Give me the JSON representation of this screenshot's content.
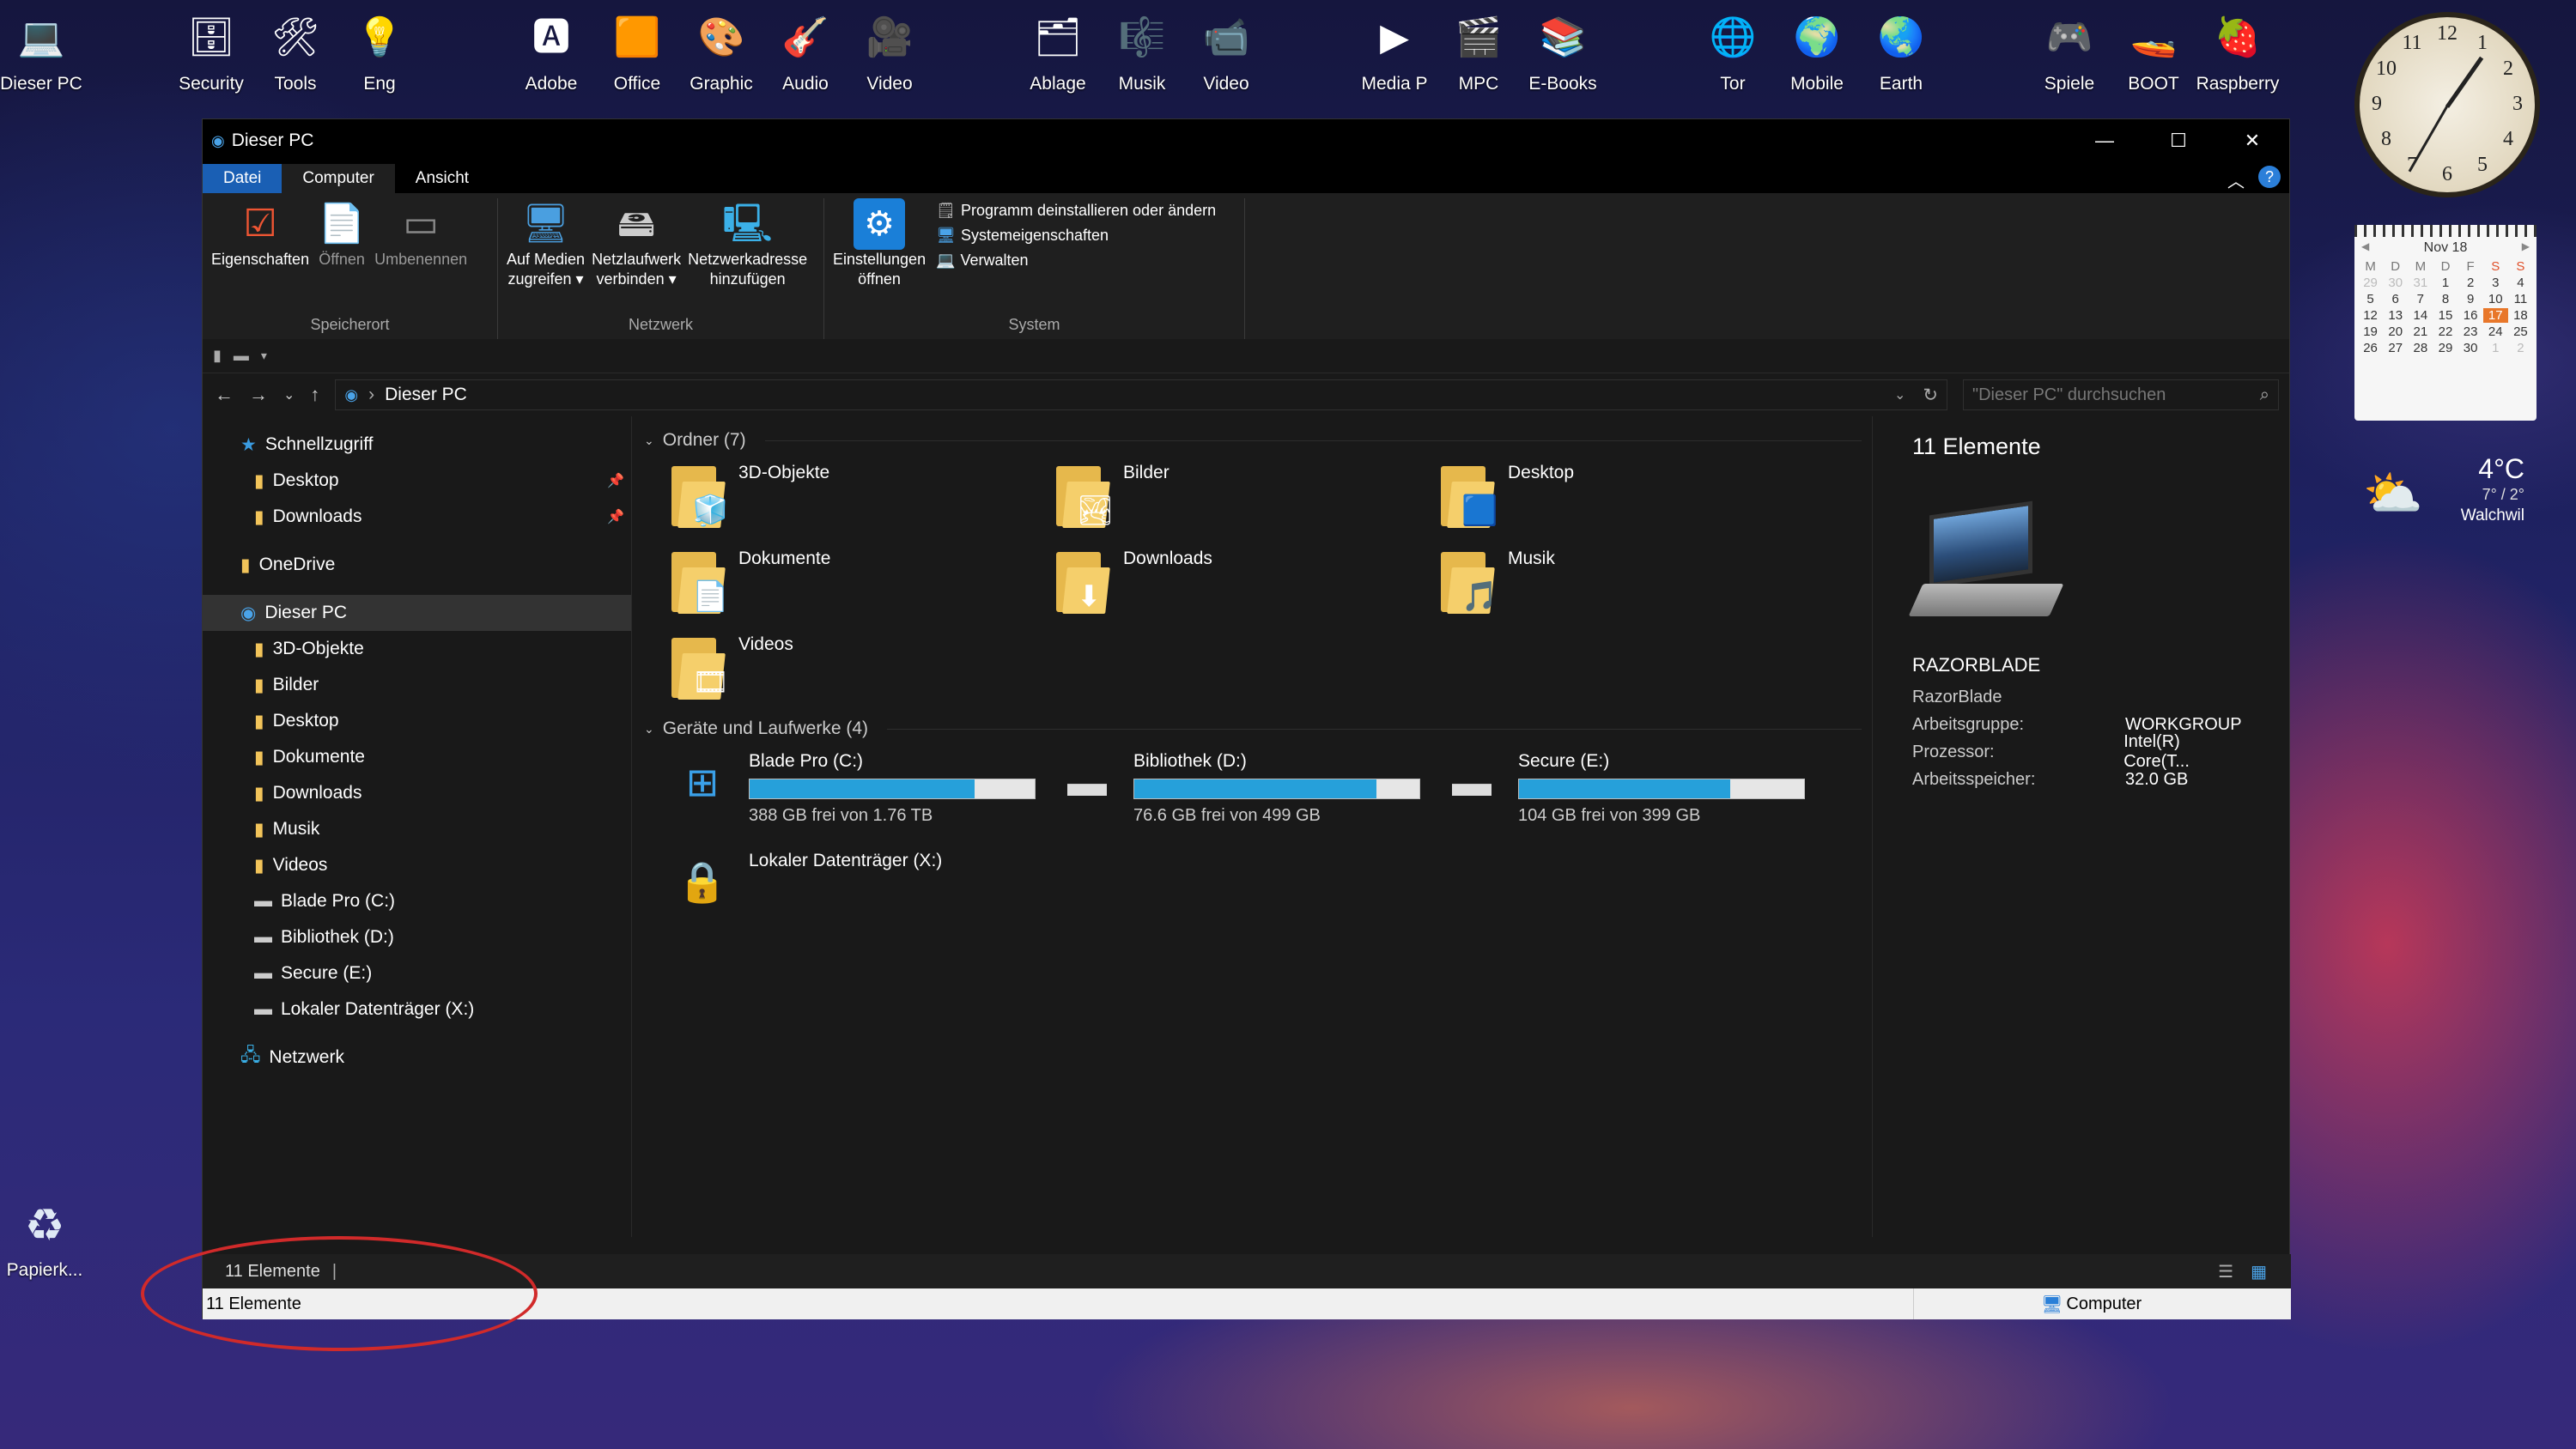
{
  "desktop": {
    "icons": [
      {
        "label": "Dieser PC",
        "glyph": "💻"
      },
      {
        "label": "Security",
        "glyph": "🗄"
      },
      {
        "label": "Tools",
        "glyph": "🛠"
      },
      {
        "label": "Eng",
        "glyph": "💡"
      },
      {
        "label": "Adobe",
        "glyph": "🅰"
      },
      {
        "label": "Office",
        "glyph": "🟧"
      },
      {
        "label": "Graphic",
        "glyph": "🎨"
      },
      {
        "label": "Audio",
        "glyph": "🎸"
      },
      {
        "label": "Video",
        "glyph": "🎥"
      },
      {
        "label": "Ablage",
        "glyph": "🗂"
      },
      {
        "label": "Musik",
        "glyph": "🎼"
      },
      {
        "label": "Video",
        "glyph": "📹"
      },
      {
        "label": "Media P",
        "glyph": "▶"
      },
      {
        "label": "MPC",
        "glyph": "🎬"
      },
      {
        "label": "E-Books",
        "glyph": "📚"
      },
      {
        "label": "Tor",
        "glyph": "🌐"
      },
      {
        "label": "Mobile",
        "glyph": "🌍"
      },
      {
        "label": "Earth",
        "glyph": "🌏"
      },
      {
        "label": "Spiele",
        "glyph": "🎮"
      },
      {
        "label": "BOOT",
        "glyph": "🚤"
      },
      {
        "label": "Raspberry",
        "glyph": "🍓"
      }
    ],
    "recycle_label": "Papierk..."
  },
  "clock": {
    "numbers": [
      "12",
      "1",
      "2",
      "3",
      "4",
      "5",
      "6",
      "7",
      "8",
      "9",
      "10",
      "11"
    ]
  },
  "calendar": {
    "month": "Nov 18",
    "prev": "◀",
    "next": "▶",
    "weekdays": [
      "M",
      "D",
      "M",
      "D",
      "F",
      "S",
      "S"
    ],
    "days": [
      "29",
      "30",
      "31",
      "1",
      "2",
      "3",
      "4",
      "5",
      "6",
      "7",
      "8",
      "9",
      "10",
      "11",
      "12",
      "13",
      "14",
      "15",
      "16",
      "17",
      "18",
      "19",
      "20",
      "21",
      "22",
      "23",
      "24",
      "25",
      "26",
      "27",
      "28",
      "29",
      "30",
      "1",
      "2"
    ],
    "today": "17"
  },
  "weather": {
    "temp": "4°C",
    "range": "7° / 2°",
    "city": "Walchwil"
  },
  "window": {
    "title": "Dieser PC",
    "controls": {
      "min": "—",
      "max": "☐",
      "close": "✕"
    },
    "tabs": {
      "file": "Datei",
      "computer": "Computer",
      "view": "Ansicht"
    },
    "ribbon": {
      "groups": [
        {
          "label": "Speicherort"
        },
        {
          "label": "Netzwerk"
        },
        {
          "label": "System"
        }
      ],
      "eigenschaften": "Eigenschaften",
      "oeffnen": "Öffnen",
      "umbenennen": "Umbenennen",
      "medien1": "Auf Medien",
      "medien2": "zugreifen ▾",
      "netz1": "Netzlaufwerk",
      "netz2": "verbinden ▾",
      "netzadr1": "Netzwerkadresse",
      "netzadr2": "hinzufügen",
      "einst1": "Einstellungen",
      "einst2": "öffnen",
      "programm": "Programm deinstallieren oder ändern",
      "systemeig": "Systemeigenschaften",
      "verwalten": "Verwalten"
    },
    "address": {
      "path": "Dieser PC",
      "search_placeholder": "\"Dieser PC\" durchsuchen"
    },
    "nav": {
      "quick": "Schnellzugriff",
      "quick_items": [
        "Desktop",
        "Downloads"
      ],
      "onedrive": "OneDrive",
      "thispc": "Dieser PC",
      "pc_items": [
        "3D-Objekte",
        "Bilder",
        "Desktop",
        "Dokumente",
        "Downloads",
        "Musik",
        "Videos",
        "Blade Pro (C:)",
        "Bibliothek (D:)",
        "Secure (E:)",
        "Lokaler Datenträger (X:)"
      ],
      "network": "Netzwerk"
    },
    "folders_header": "Ordner (7)",
    "folders": [
      {
        "name": "3D-Objekte",
        "ovl": "🧊"
      },
      {
        "name": "Bilder",
        "ovl": "🏞"
      },
      {
        "name": "Desktop",
        "ovl": "🟦"
      },
      {
        "name": "Dokumente",
        "ovl": "📄"
      },
      {
        "name": "Downloads",
        "ovl": "⬇"
      },
      {
        "name": "Musik",
        "ovl": "🎵"
      },
      {
        "name": "Videos",
        "ovl": "🎞"
      }
    ],
    "drives_header": "Geräte und Laufwerke (4)",
    "drives": [
      {
        "name": "Blade Pro (C:)",
        "free": "388 GB frei von 1.76 TB",
        "used_fraction": 0.79
      },
      {
        "name": "Bibliothek (D:)",
        "free": "76.6 GB frei von 499 GB",
        "used_fraction": 0.85
      },
      {
        "name": "Secure (E:)",
        "free": "104 GB frei von 399 GB",
        "used_fraction": 0.74
      }
    ],
    "local_drive": "Lokaler Datenträger (X:)",
    "details": {
      "count": "11 Elemente",
      "pcname": "RAZORBLADE",
      "sub": "RazorBlade",
      "rows": [
        {
          "k": "Arbeitsgruppe:",
          "v": "WORKGROUP"
        },
        {
          "k": "Prozessor:",
          "v": "Intel(R) Core(T..."
        },
        {
          "k": "Arbeitsspeicher:",
          "v": "32.0 GB"
        }
      ]
    },
    "status": {
      "count": "11 Elemente",
      "count2": "11 Elemente",
      "zone": "Computer"
    }
  },
  "colors": {
    "accent": "#1a5fb4",
    "bar_fill": "#26a0da",
    "annotation": "#d12a2a"
  }
}
